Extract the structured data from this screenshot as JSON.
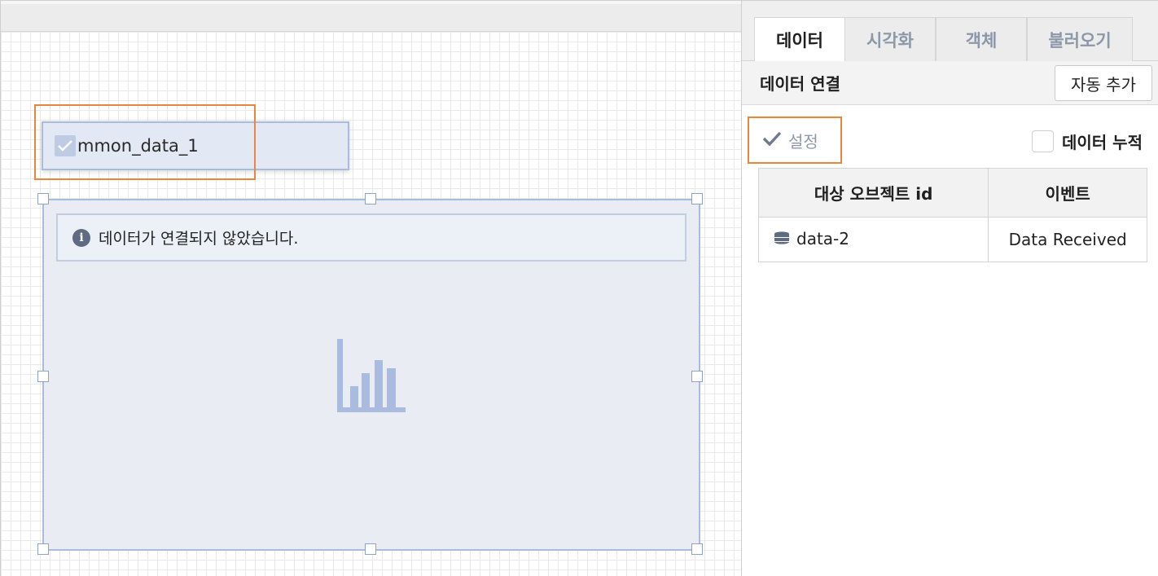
{
  "canvas": {
    "checkbox_widget": {
      "label": "mmon_data_1",
      "checked": true
    },
    "chart_widget": {
      "notice": "데이터가 연결되지 않았습니다.",
      "placeholder_icon": "bar-chart-icon"
    }
  },
  "panel": {
    "tabs": [
      {
        "label": "데이터",
        "active": true
      },
      {
        "label": "시각화",
        "active": false
      },
      {
        "label": "객체",
        "active": false
      },
      {
        "label": "불러오기",
        "active": false
      }
    ],
    "connection": {
      "title": "데이터 연결",
      "auto_add_label": "자동 추가",
      "setting_label": "설정",
      "accumulate_label": "데이터 누적",
      "accumulate_checked": false
    },
    "table": {
      "headers": [
        "대상 오브젝트 id",
        "이벤트"
      ],
      "rows": [
        {
          "object_id": "data-2",
          "event": "Data Received"
        }
      ]
    }
  },
  "colors": {
    "selection_accent": "#e9853e",
    "widget_border": "#a9bce0",
    "chart_icon": "#a9bce0"
  }
}
